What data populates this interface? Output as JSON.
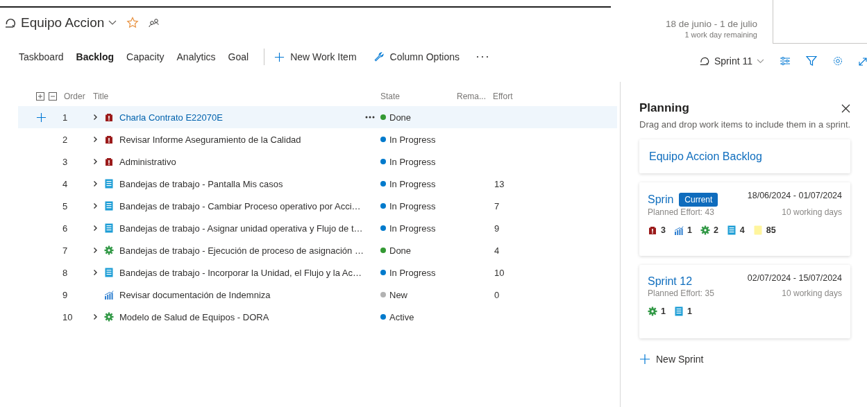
{
  "header": {
    "team": "Equipo Accion",
    "sprint_dates": "18 de junio - 1 de julio",
    "remaining": "1 work day remaining"
  },
  "tabs": [
    {
      "label": "Taskboard",
      "selected": false
    },
    {
      "label": "Backlog",
      "selected": true
    },
    {
      "label": "Capacity",
      "selected": false
    },
    {
      "label": "Analytics",
      "selected": false
    },
    {
      "label": "Goal",
      "selected": false
    }
  ],
  "toolbar": {
    "new_item": "New Work Item",
    "column_options": "Column Options",
    "sprint_picker": "Sprint 11"
  },
  "table": {
    "columns": [
      "Order",
      "Title",
      "State",
      "Rema...",
      "Effort"
    ],
    "rows": [
      {
        "order": "1",
        "title": "Charla Contrato E22070E",
        "kind": "impediment",
        "expandable": true,
        "state": "Done",
        "color": "#339933",
        "selected": true
      },
      {
        "order": "2",
        "title": "Revisar Informe Aseguramiento de la Calidad",
        "kind": "impediment",
        "expandable": true,
        "state": "In Progress",
        "color": "#007acc",
        "selected": false
      },
      {
        "order": "3",
        "title": "Administrativo",
        "kind": "impediment",
        "expandable": true,
        "state": "In Progress",
        "color": "#007acc",
        "selected": false
      },
      {
        "order": "4",
        "title": "Bandejas de trabajo - Pantalla Mis casos",
        "kind": "item",
        "expandable": true,
        "state": "In Progress",
        "color": "#007acc",
        "effort": "13",
        "selected": false
      },
      {
        "order": "5",
        "title": "Bandejas de trabajo - Cambiar Proceso operativo por Acci…",
        "kind": "item",
        "expandable": true,
        "state": "In Progress",
        "color": "#007acc",
        "effort": "7",
        "selected": false
      },
      {
        "order": "6",
        "title": "Bandejas de trabajo - Asignar unidad operativa y Flujo de t…",
        "kind": "item",
        "expandable": true,
        "state": "In Progress",
        "color": "#007acc",
        "effort": "9",
        "selected": false
      },
      {
        "order": "7",
        "title": "Bandejas de trabajo - Ejecución de proceso de asignación …",
        "kind": "feature",
        "expandable": true,
        "state": "Done",
        "color": "#339933",
        "effort": "4",
        "selected": false
      },
      {
        "order": "8",
        "title": "Bandejas de trabajo - Incorporar la Unidad, el Flujo y la Ac…",
        "kind": "item",
        "expandable": true,
        "state": "In Progress",
        "color": "#007acc",
        "effort": "10",
        "selected": false
      },
      {
        "order": "9",
        "title": "Revisar documentación de Indemniza",
        "kind": "metric",
        "expandable": false,
        "state": "New",
        "color": "#b2b2b2",
        "effort": "0",
        "selected": false
      },
      {
        "order": "10",
        "title": "Modelo de Salud de Equipos - DORA",
        "kind": "feature",
        "expandable": true,
        "state": "Active",
        "color": "#007acc",
        "selected": false
      }
    ]
  },
  "planning": {
    "title": "Planning",
    "description": "Drag and drop work items to include them in a sprint.",
    "backlog_link": "Equipo Accion Backlog",
    "sprints": [
      {
        "name": "Sprin",
        "badge": "Current",
        "dates": "18/06/2024 - 01/07/2024",
        "planned_effort": "Planned Effort: 43",
        "working_days": "10 working days",
        "counts": [
          {
            "kind": "impediment",
            "count": "3"
          },
          {
            "kind": "metric",
            "count": "1"
          },
          {
            "kind": "feature",
            "count": "2"
          },
          {
            "kind": "item",
            "count": "4"
          },
          {
            "kind": "effort",
            "count": "85"
          }
        ]
      },
      {
        "name": "Sprint 12",
        "dates": "02/07/2024 - 15/07/2024",
        "planned_effort": "Planned Effort: 35",
        "working_days": "10 working days",
        "counts": [
          {
            "kind": "feature",
            "count": "1"
          },
          {
            "kind": "item",
            "count": "1"
          }
        ]
      }
    ],
    "new_sprint": "New Sprint"
  }
}
